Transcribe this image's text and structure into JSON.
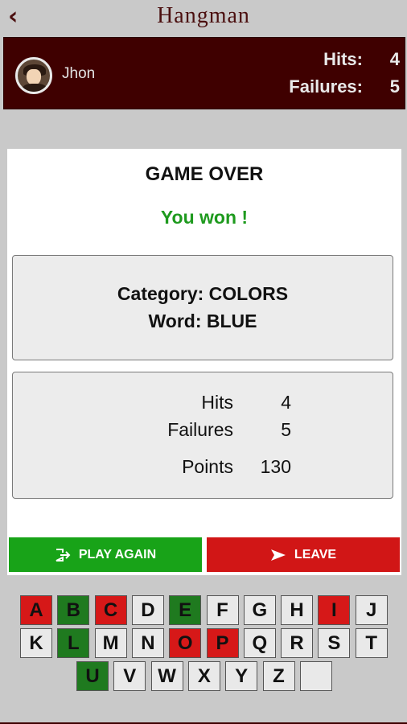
{
  "header": {
    "back_icon": "arrow-left-icon",
    "title": "Hangman"
  },
  "player": {
    "name": "Jhon",
    "hits_label": "Hits:",
    "hits_value": "4",
    "failures_label": "Failures:",
    "failures_value": "5"
  },
  "result": {
    "title": "GAME OVER",
    "message": "You won !",
    "category": "Category: COLORS",
    "word": "Word: BLUE",
    "stats": [
      {
        "label": "Hits",
        "value": "4"
      },
      {
        "label": "Failures",
        "value": "5"
      },
      {
        "label": "Points",
        "value": "130"
      }
    ]
  },
  "buttons": {
    "play_again": "PLAY AGAIN",
    "leave": "LEAVE"
  },
  "colors": {
    "header_bg": "#3f0000",
    "hit": "#1f7a1f",
    "miss": "#d61818",
    "play": "#18a318",
    "leave": "#d11616",
    "won_text": "#1e9a1e"
  },
  "keyboard": {
    "rows": [
      [
        {
          "letter": "A",
          "state": "miss"
        },
        {
          "letter": "B",
          "state": "hit"
        },
        {
          "letter": "C",
          "state": "miss"
        },
        {
          "letter": "D",
          "state": "unused"
        },
        {
          "letter": "E",
          "state": "hit"
        },
        {
          "letter": "F",
          "state": "unused"
        },
        {
          "letter": "G",
          "state": "unused"
        },
        {
          "letter": "H",
          "state": "unused"
        },
        {
          "letter": "I",
          "state": "miss"
        },
        {
          "letter": "J",
          "state": "unused"
        }
      ],
      [
        {
          "letter": "K",
          "state": "unused"
        },
        {
          "letter": "L",
          "state": "hit"
        },
        {
          "letter": "M",
          "state": "unused"
        },
        {
          "letter": "N",
          "state": "unused"
        },
        {
          "letter": "O",
          "state": "miss"
        },
        {
          "letter": "P",
          "state": "miss"
        },
        {
          "letter": "Q",
          "state": "unused"
        },
        {
          "letter": "R",
          "state": "unused"
        },
        {
          "letter": "S",
          "state": "unused"
        },
        {
          "letter": "T",
          "state": "unused"
        }
      ],
      [
        {
          "letter": "U",
          "state": "hit"
        },
        {
          "letter": "V",
          "state": "unused"
        },
        {
          "letter": "W",
          "state": "unused"
        },
        {
          "letter": "X",
          "state": "unused"
        },
        {
          "letter": "Y",
          "state": "unused"
        },
        {
          "letter": "Z",
          "state": "unused"
        },
        {
          "letter": "",
          "state": "blank"
        }
      ]
    ]
  }
}
